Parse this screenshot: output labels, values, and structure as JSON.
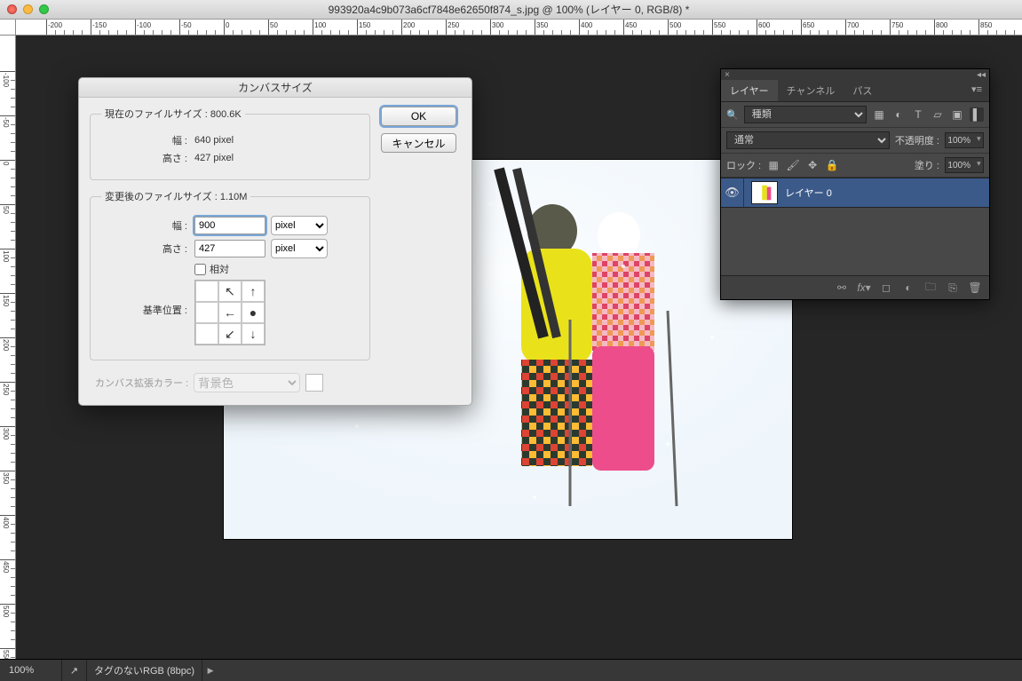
{
  "titlebar": {
    "filename": "993920a4c9b073a6cf7848e62650f874_s.jpg @ 100% (レイヤー 0, RGB/8) *"
  },
  "dialog": {
    "title": "カンバスサイズ",
    "current_legend": "現在のファイルサイズ : 800.6K",
    "width_label": "幅 :",
    "width_value": "640 pixel",
    "height_label": "高さ :",
    "height_value": "427 pixel",
    "new_legend": "変更後のファイルサイズ : 1.10M",
    "new_width_label": "幅 :",
    "new_width_value": "900",
    "new_width_unit": "pixel",
    "new_height_label": "高さ :",
    "new_height_value": "427",
    "new_height_unit": "pixel",
    "relative_label": "相対",
    "anchor_label": "基準位置 :",
    "ext_color_label": "カンバス拡張カラー :",
    "ext_color_value": "背景色",
    "btn_ok": "OK",
    "btn_cancel": "キャンセル"
  },
  "panel": {
    "tabs": {
      "layers": "レイヤー",
      "channels": "チャンネル",
      "paths": "パス"
    },
    "filter_kind": "種類",
    "blend_mode": "通常",
    "opacity_label": "不透明度 :",
    "opacity_value": "100%",
    "lock_label": "ロック :",
    "fill_label": "塗り :",
    "fill_value": "100%",
    "layer0_name": "レイヤー 0"
  },
  "status": {
    "zoom": "100%",
    "info": "タグのないRGB (8bpc)"
  }
}
